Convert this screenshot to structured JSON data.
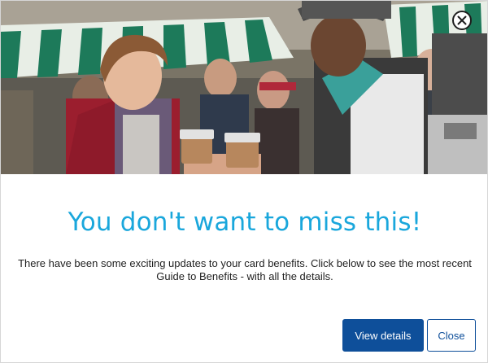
{
  "dialog": {
    "hero_image": "market-coffee-photo",
    "close_icon": "close-icon",
    "title": "You don't want to miss this!",
    "body": "There have been some exciting updates to your card benefits. Click below to see the most recent Guide to Benefits - with all the details.",
    "primary_label": "View details",
    "secondary_label": "Close"
  },
  "colors": {
    "title": "#1aa7dc",
    "primary_button": "#0e4f9a",
    "body_text": "#222222"
  }
}
